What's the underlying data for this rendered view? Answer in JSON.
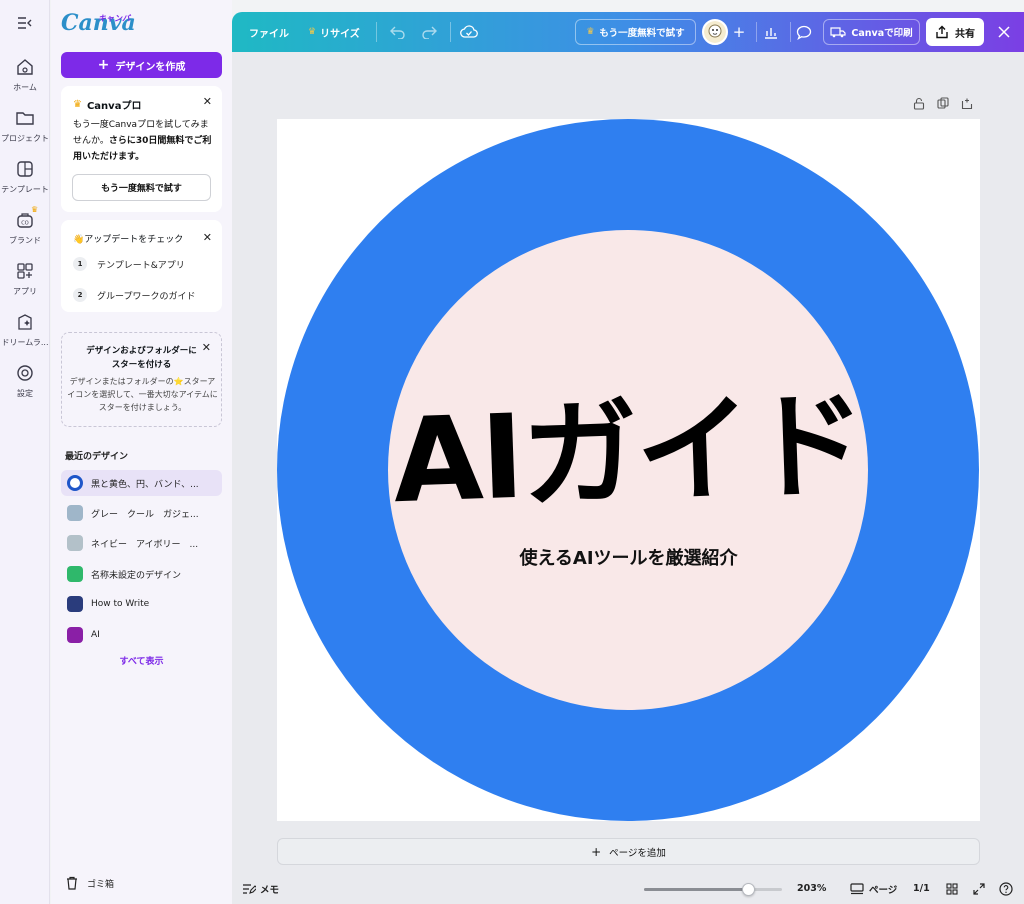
{
  "rail": {
    "items": [
      {
        "label": "ホーム",
        "icon": "home-icon"
      },
      {
        "label": "プロジェクト",
        "icon": "folder-icon"
      },
      {
        "label": "テンプレート",
        "icon": "template-icon"
      },
      {
        "label": "ブランド",
        "icon": "brand-icon"
      },
      {
        "label": "アプリ",
        "icon": "apps-icon"
      },
      {
        "label": "ドリームラ...",
        "icon": "dream-lab-icon"
      },
      {
        "label": "設定",
        "icon": "settings-icon"
      }
    ]
  },
  "panel": {
    "logo": "Canva",
    "logo_kana": "キャンバ",
    "create_label": "デザインを作成",
    "pro_card": {
      "title": "Canvaプロ",
      "body_plain": "もう一度Canvaプロを試してみませんか。",
      "body_bold": "さらに30日間無料でご利用いただけます。",
      "button": "もう一度無料で試す"
    },
    "update_card": {
      "title": "👋アップデートをチェック",
      "items": [
        {
          "num": "1",
          "label": "テンプレート&アプリ"
        },
        {
          "num": "2",
          "label": "グループワークのガイド"
        }
      ]
    },
    "star_card": {
      "title": "デザインおよびフォルダーにスターを付ける",
      "body": "デザインまたはフォルダーの⭐スターアイコンを選択して、一番大切なアイテムにスターを付けましょう。"
    },
    "recent_heading": "最近のデザイン",
    "recent": [
      {
        "label": "黒と黄色、円、バンド、...",
        "color": "#1f56c9"
      },
      {
        "label": "グレー　クール　ガジェ...",
        "color": "#9fb6c9"
      },
      {
        "label": "ネイビー　アイボリー　...",
        "color": "#b3c1c9"
      },
      {
        "label": "名称未設定のデザイン",
        "color": "#2fb86b"
      },
      {
        "label": "How to Write",
        "color": "#2a3c7c"
      },
      {
        "label": "AI",
        "color": "#8a1fa6"
      }
    ],
    "show_all": "すべて表示",
    "trash": "ゴミ箱"
  },
  "toolbar": {
    "file": "ファイル",
    "resize": "リサイズ",
    "trial": "もう一度無料で試す",
    "print": "Canvaで印刷",
    "share": "共有"
  },
  "canvas": {
    "headline": "AIガイド",
    "subtitle": "使えるAIツールを厳選紹介",
    "ring_color": "#2f7ff0",
    "inner_color": "#f9e8e8",
    "add_page": "ページを追加"
  },
  "bottom": {
    "memo": "メモ",
    "zoom": "203%",
    "zoom_fraction": 0.75,
    "pages": "ページ",
    "page_count": "1/1"
  },
  "colors": {
    "accent": "#7d2ae8"
  }
}
